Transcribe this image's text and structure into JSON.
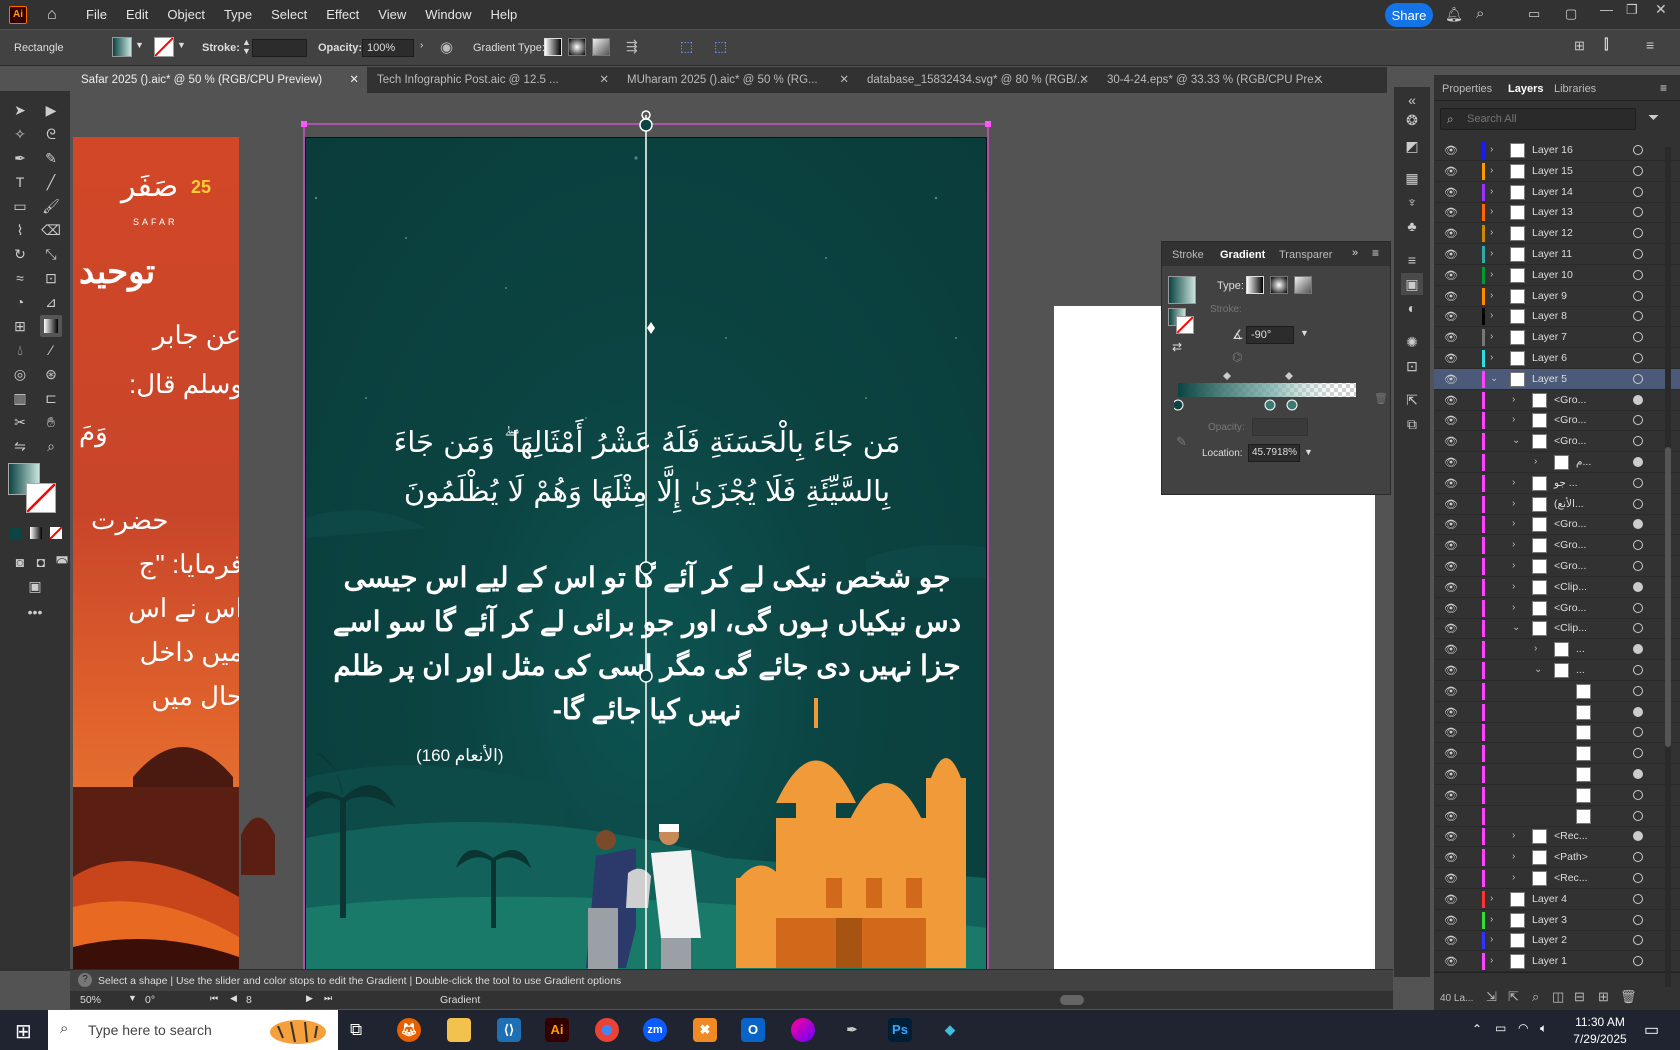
{
  "menubar": {
    "logo": "Ai",
    "items": [
      "File",
      "Edit",
      "Object",
      "Type",
      "Select",
      "Effect",
      "View",
      "Window",
      "Help"
    ],
    "share": "Share"
  },
  "control": {
    "object_type": "Rectangle",
    "stroke_label": "Stroke:",
    "opacity_label": "Opacity:",
    "opacity_value": "100%",
    "gradient_type_label": "Gradient Type:"
  },
  "tabs": [
    {
      "label": "Safar 2025 ().aic* @ 50 % (RGB/CPU Preview)",
      "active": true
    },
    {
      "label": "Tech Infographic Post.aic @ 12.5 ...",
      "active": false
    },
    {
      "label": "MUharam 2025 ().aic* @ 50 % (RG...",
      "active": false
    },
    {
      "label": "database_15832434.svg* @ 80 % (RGB/...",
      "active": false
    },
    {
      "label": "30-4-24.eps* @ 33.33 % (RGB/CPU Pre...",
      "active": false
    }
  ],
  "artboard_left": {
    "logo_ar": "صَفَر",
    "logo_num": "25",
    "logo_en": "SAFAR",
    "heading": "توحید",
    "lines": [
      "عن جابر",
      "وسلم قال:",
      "وَمَ",
      "حضرت",
      "فرمایا: \"ج",
      "اس نے اس",
      "میں داخل",
      "حال میں"
    ]
  },
  "artboard_main": {
    "ayah_line1": "مَن جَاءَ بِالْحَسَنَةِ فَلَهُ عَشْرُ أَمْثَالِهَا ۖ وَمَن جَاءَ",
    "ayah_line2": "بِالسَّيِّئَةِ فَلَا يُجْزَىٰ إِلَّا مِثْلَهَا وَهُمْ لَا يُظْلَمُونَ",
    "urdu_lines": [
      "جو شخص نیکی لے کر آئے گا تو اس کے لیے اس جیسی",
      "دس نیکیاں ہوں گی، اور جو برائی لے کر آئے گا سو اسے",
      "جزا نہیں دی جائے گی مگر اسی کی مثل اور ان پر ظلم",
      "نہیں کیا جائے گا-"
    ],
    "reference": "(الأنعام 160)"
  },
  "gradient_panel": {
    "tabs": [
      "Stroke",
      "Gradient",
      "Transparer"
    ],
    "type_label": "Type:",
    "stroke_label": "Stroke:",
    "angle": "-90°",
    "opacity_label": "Opacity:",
    "location_label": "Location:",
    "location_value": "45.7918%"
  },
  "layers_panel": {
    "tabs": [
      "Properties",
      "Layers",
      "Libraries"
    ],
    "search_placeholder": "Search All",
    "footer": "40 La...",
    "rows": [
      {
        "name": "Layer 16",
        "color": "#1a1aff",
        "indent": 0
      },
      {
        "name": "Layer 15",
        "color": "#ff9900",
        "indent": 0
      },
      {
        "name": "Layer 14",
        "color": "#9933ff",
        "indent": 0
      },
      {
        "name": "Layer 13",
        "color": "#ff6600",
        "indent": 0
      },
      {
        "name": "Layer 12",
        "color": "#cc8800",
        "indent": 0
      },
      {
        "name": "Layer 11",
        "color": "#33aaaa",
        "indent": 0
      },
      {
        "name": "Layer 10",
        "color": "#009933",
        "indent": 0
      },
      {
        "name": "Layer 9",
        "color": "#ff8800",
        "indent": 0
      },
      {
        "name": "Layer 8",
        "color": "#000000",
        "indent": 0
      },
      {
        "name": "Layer 7",
        "color": "#777777",
        "indent": 0
      },
      {
        "name": "Layer 6",
        "color": "#33dddd",
        "indent": 0
      },
      {
        "name": "Layer 5",
        "color": "#ff44ff",
        "indent": 0,
        "selected": true
      },
      {
        "name": "<Gro...",
        "color": "#ff44ff",
        "indent": 1
      },
      {
        "name": "<Gro...",
        "color": "#ff44ff",
        "indent": 1
      },
      {
        "name": "<Gro...",
        "color": "#ff44ff",
        "indent": 1
      },
      {
        "name": "م...",
        "color": "#ff44ff",
        "indent": 2
      },
      {
        "name": "جو ...",
        "color": "#ff44ff",
        "indent": 1
      },
      {
        "name": "(الأنع...",
        "color": "#ff44ff",
        "indent": 1
      },
      {
        "name": "<Gro...",
        "color": "#ff44ff",
        "indent": 1
      },
      {
        "name": "<Gro...",
        "color": "#ff44ff",
        "indent": 1
      },
      {
        "name": "<Gro...",
        "color": "#ff44ff",
        "indent": 1
      },
      {
        "name": "<Clip...",
        "color": "#ff44ff",
        "indent": 1
      },
      {
        "name": "<Gro...",
        "color": "#ff44ff",
        "indent": 1
      },
      {
        "name": "<Clip...",
        "color": "#ff44ff",
        "indent": 1
      },
      {
        "name": "...",
        "color": "#ff44ff",
        "indent": 2
      },
      {
        "name": "...",
        "color": "#ff44ff",
        "indent": 2
      },
      {
        "name": "",
        "color": "#ff44ff",
        "indent": 3
      },
      {
        "name": "",
        "color": "#ff44ff",
        "indent": 3
      },
      {
        "name": "",
        "color": "#ff44ff",
        "indent": 3
      },
      {
        "name": "",
        "color": "#ff44ff",
        "indent": 3
      },
      {
        "name": "",
        "color": "#ff44ff",
        "indent": 3
      },
      {
        "name": "",
        "color": "#ff44ff",
        "indent": 3
      },
      {
        "name": "",
        "color": "#ff44ff",
        "indent": 3
      },
      {
        "name": "<Rec...",
        "color": "#ff44ff",
        "indent": 1
      },
      {
        "name": "<Path>",
        "color": "#ff44ff",
        "indent": 1
      },
      {
        "name": "<Rec...",
        "color": "#ff44ff",
        "indent": 1
      },
      {
        "name": "Layer 4",
        "color": "#ff3333",
        "indent": 0
      },
      {
        "name": "Layer 3",
        "color": "#33dd33",
        "indent": 0
      },
      {
        "name": "Layer 2",
        "color": "#3333ff",
        "indent": 0
      },
      {
        "name": "Layer 1",
        "color": "#ff44ff",
        "indent": 0
      }
    ]
  },
  "status": {
    "hint": "Select a shape | Use the slider and color stops to edit the Gradient | Double-click the tool to use Gradient options",
    "zoom": "50%",
    "rotation": "0°",
    "artboard_num": "8",
    "tool_name": "Gradient"
  },
  "taskbar": {
    "search_placeholder": "Type here to search",
    "time": "11:30 AM",
    "date": "7/29/2025"
  }
}
